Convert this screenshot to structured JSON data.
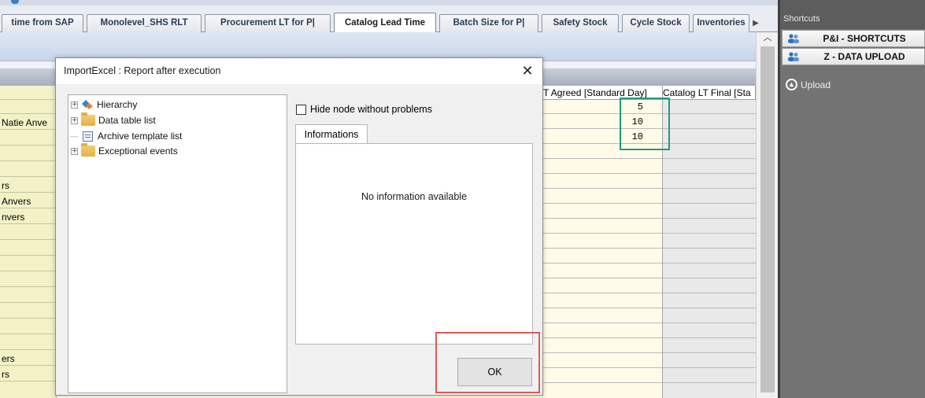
{
  "tabs": {
    "items": [
      {
        "label": "time from SAP"
      },
      {
        "label": "Monolevel_SHS RLT"
      },
      {
        "label": "Procurement LT for P|"
      },
      {
        "label": "Catalog Lead Time"
      },
      {
        "label": "Batch Size for P|"
      },
      {
        "label": "Safety Stock"
      },
      {
        "label": "Cycle Stock"
      },
      {
        "label": "Inventories"
      }
    ],
    "active_index": 3,
    "scroll_icon": "triangle-right-icon"
  },
  "grid": {
    "left_rows": [
      "",
      "",
      "Natie Anve",
      "",
      "",
      "",
      "rs",
      "Anvers",
      "nvers",
      "",
      "",
      "",
      "",
      "",
      "",
      "",
      "",
      "",
      "ers",
      "rs"
    ],
    "agreed_header": "T Agreed [Standard Day]",
    "final_header": "Catalog LT Final [Sta",
    "agreed_values": [
      "5",
      "10",
      "10"
    ],
    "scroll_up_icon": "chevron-up-icon"
  },
  "dialog": {
    "title": "ImportExcel : Report after execution",
    "close_label": "✕",
    "tree": [
      {
        "label": "Hierarchy",
        "icon": "diamond-icon",
        "expandable": true
      },
      {
        "label": "Data table list",
        "icon": "folder-icon",
        "expandable": true
      },
      {
        "label": "Archive template list",
        "icon": "archive-icon",
        "expandable": false
      },
      {
        "label": "Exceptional events",
        "icon": "folder-icon",
        "expandable": true
      }
    ],
    "hide_node_label": "Hide node without problems",
    "info_tab_label": "Informations",
    "info_empty_text": "No information available",
    "ok_label": "OK"
  },
  "shortcuts": {
    "header": "Shortcuts",
    "items": [
      {
        "label": "P&I - SHORTCUTS",
        "icon": "people-icon"
      },
      {
        "label": "Z - DATA UPLOAD",
        "icon": "people-icon"
      }
    ],
    "upload_label": "Upload",
    "upload_icon": "upload-arrow-icon"
  },
  "colors": {
    "highlight_green": "#1e9b7a",
    "highlight_red": "#e05a4f",
    "active_tab_text": "#1a1a1a"
  }
}
